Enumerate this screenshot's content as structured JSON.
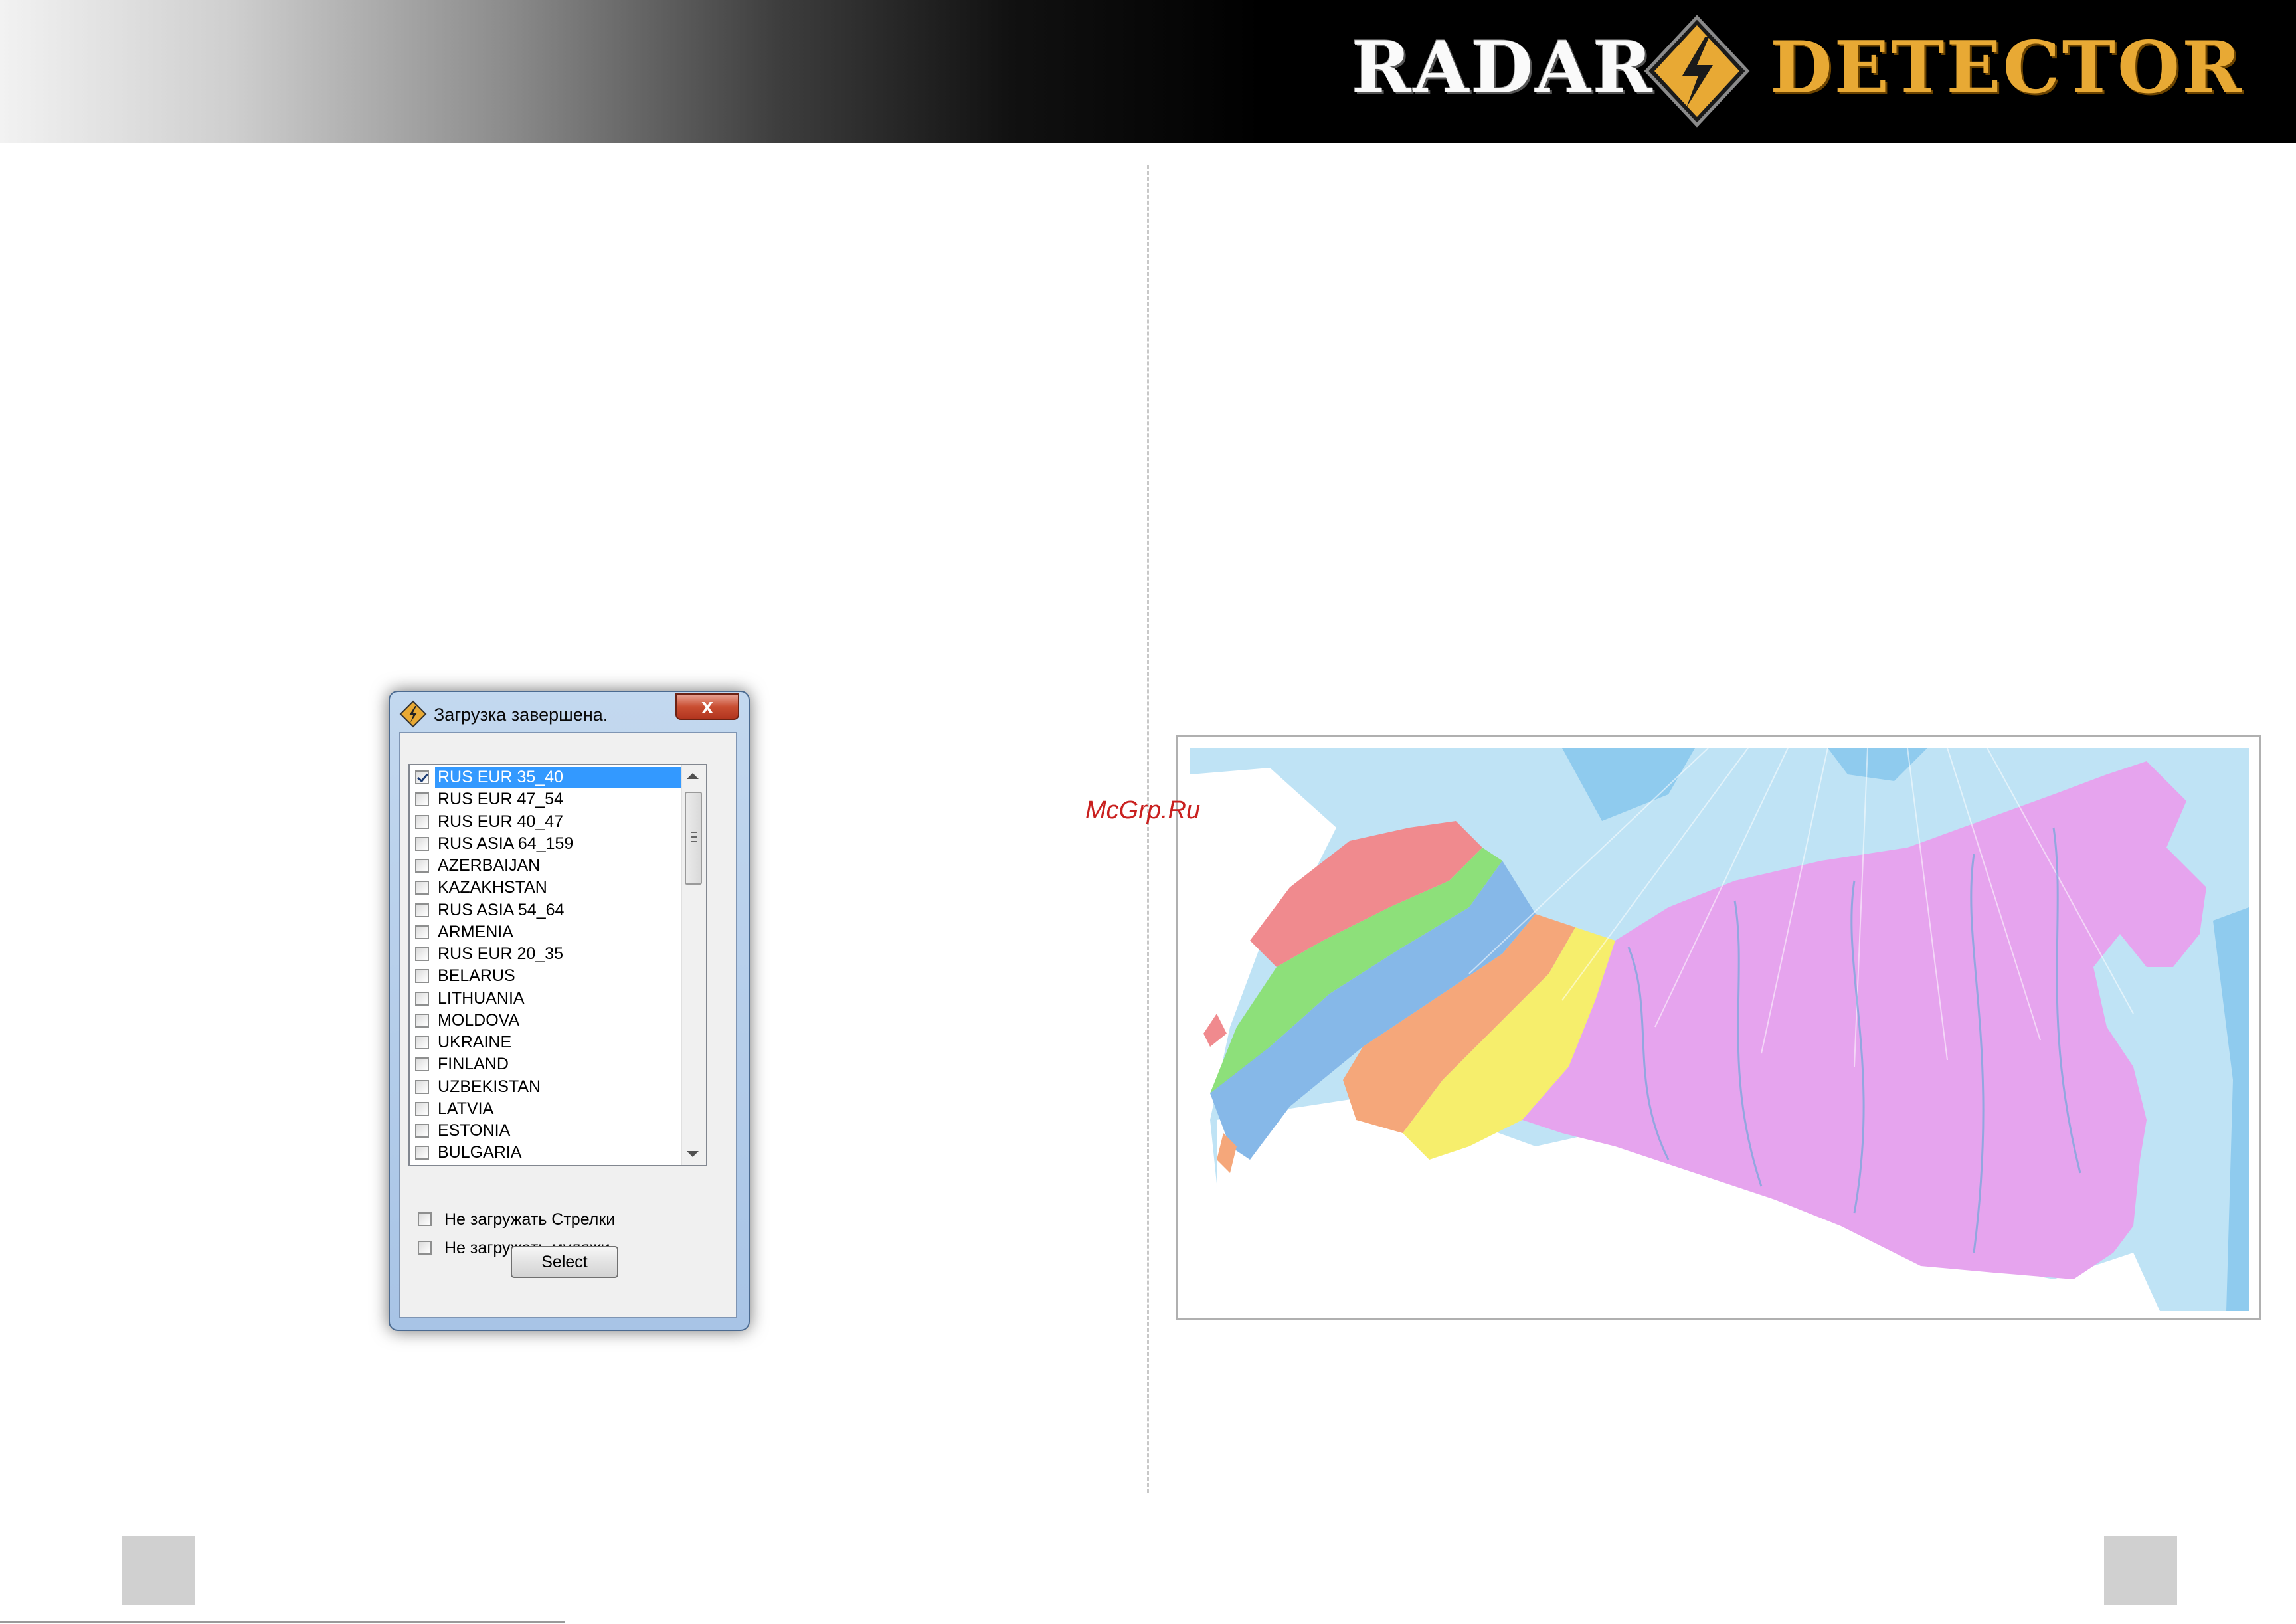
{
  "header": {
    "logo_left": "RADAR",
    "logo_right": "DETECTOR",
    "logo_icon": "lightning-bolt-diamond-icon",
    "accent_color": "#e8a934"
  },
  "watermark": "McGrp.Ru",
  "dialog": {
    "title": "Загрузка завершена.",
    "icon": "warning-bolt-icon",
    "close_label": "x",
    "items": [
      {
        "label": "RUS EUR 35_40",
        "checked": true,
        "selected": true
      },
      {
        "label": "RUS EUR 47_54",
        "checked": false
      },
      {
        "label": "RUS EUR 40_47",
        "checked": false
      },
      {
        "label": "RUS ASIA 64_159",
        "checked": false
      },
      {
        "label": "AZERBAIJAN",
        "checked": false
      },
      {
        "label": "KAZAKHSTAN",
        "checked": false
      },
      {
        "label": "RUS ASIA 54_64",
        "checked": false
      },
      {
        "label": "ARMENIA",
        "checked": false
      },
      {
        "label": "RUS EUR 20_35",
        "checked": false
      },
      {
        "label": "BELARUS",
        "checked": false
      },
      {
        "label": "LITHUANIA",
        "checked": false
      },
      {
        "label": "MOLDOVA",
        "checked": false
      },
      {
        "label": "UKRAINE",
        "checked": false
      },
      {
        "label": "FINLAND",
        "checked": false
      },
      {
        "label": "UZBEKISTAN",
        "checked": false
      },
      {
        "label": "LATVIA",
        "checked": false
      },
      {
        "label": "ESTONIA",
        "checked": false
      },
      {
        "label": "BULGARIA",
        "checked": false
      }
    ],
    "options": [
      {
        "label": "Не загружать Стрелки",
        "checked": false
      },
      {
        "label": "Не загружать муляжи",
        "checked": false
      }
    ],
    "select_label": "Select"
  },
  "map": {
    "region_colors": {
      "eur_47_54": "#f08a8e",
      "eur_40_47": "#8de07a",
      "eur_35_40": "#86b8e8",
      "eur_20_35": "#f5a77a",
      "asia_54_64": "#f6ee6c",
      "asia_64_159": "#e6a4ee"
    },
    "ocean_color": "#bfe3f5",
    "deep_ocean_color": "#8fcbee"
  }
}
